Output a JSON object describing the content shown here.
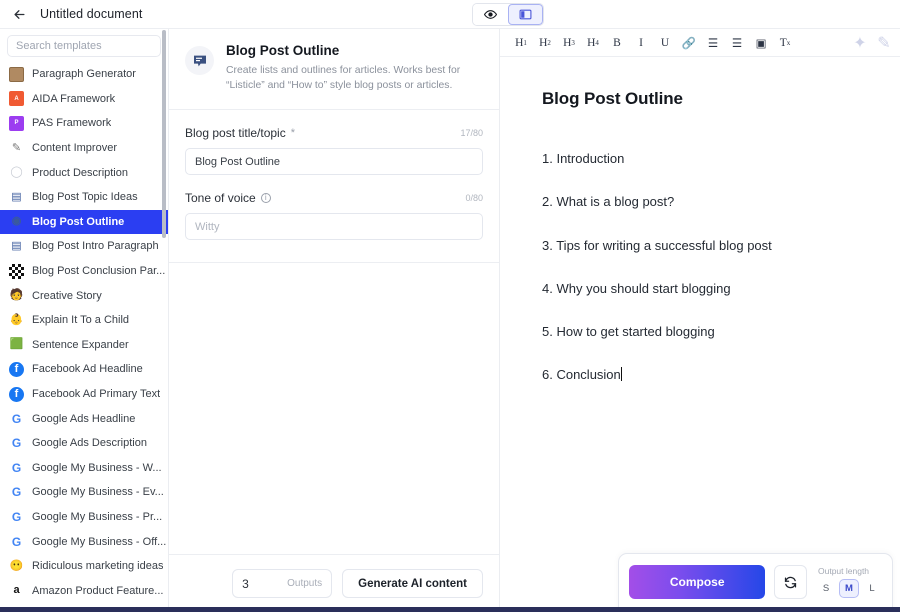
{
  "topbar": {
    "back_icon": "arrow-left-icon",
    "document_title": "Untitled document",
    "view_toggle": {
      "preview_icon": "eye-icon",
      "split_icon": "split-panel-icon",
      "active": "split"
    }
  },
  "sidebar": {
    "search": {
      "placeholder": "Search templates",
      "value": ""
    },
    "items": [
      {
        "label": "Paragraph Generator",
        "icon": "box-icon",
        "icon_class": "ic-box",
        "glyph": "",
        "selected": false
      },
      {
        "label": "AIDA Framework",
        "icon": "aida-badge-icon",
        "icon_class": "ic-aida",
        "glyph": "A",
        "selected": false
      },
      {
        "label": "PAS Framework",
        "icon": "pas-badge-icon",
        "icon_class": "ic-pas",
        "glyph": "P",
        "selected": false
      },
      {
        "label": "Content Improver",
        "icon": "magic-wand-icon",
        "icon_class": "ic-wand",
        "glyph": "✎",
        "selected": false
      },
      {
        "label": "Product Description",
        "icon": "speech-bubble-icon",
        "icon_class": "ic-bubble",
        "glyph": "◯",
        "selected": false
      },
      {
        "label": "Blog Post Topic Ideas",
        "icon": "chat-icon",
        "icon_class": "ic-chat",
        "glyph": "▤",
        "selected": false
      },
      {
        "label": "Blog Post Outline",
        "icon": "chat-circle-icon",
        "icon_class": "ic-chat",
        "glyph": "◉",
        "selected": true
      },
      {
        "label": "Blog Post Intro Paragraph",
        "icon": "chat-icon",
        "icon_class": "ic-chat",
        "glyph": "▤",
        "selected": false
      },
      {
        "label": "Blog Post Conclusion Par...",
        "icon": "checkered-flag-icon",
        "icon_class": "ic-flag",
        "glyph": "",
        "selected": false
      },
      {
        "label": "Creative Story",
        "icon": "person-icon",
        "icon_class": "",
        "glyph": "🧑",
        "selected": false
      },
      {
        "label": "Explain It To a Child",
        "icon": "baby-face-icon",
        "icon_class": "",
        "glyph": "👶",
        "selected": false
      },
      {
        "label": "Sentence Expander",
        "icon": "expand-icon",
        "icon_class": "",
        "glyph": "🟩",
        "selected": false
      },
      {
        "label": "Facebook Ad Headline",
        "icon": "facebook-icon",
        "icon_class": "ic-fb",
        "glyph": "f",
        "selected": false
      },
      {
        "label": "Facebook Ad Primary Text",
        "icon": "facebook-icon",
        "icon_class": "ic-fb",
        "glyph": "f",
        "selected": false
      },
      {
        "label": "Google Ads Headline",
        "icon": "google-icon",
        "icon_class": "ic-g",
        "glyph": "G",
        "selected": false
      },
      {
        "label": "Google Ads Description",
        "icon": "google-icon",
        "icon_class": "ic-g",
        "glyph": "G",
        "selected": false
      },
      {
        "label": "Google My Business - W...",
        "icon": "google-icon",
        "icon_class": "ic-g",
        "glyph": "G",
        "selected": false
      },
      {
        "label": "Google My Business - Ev...",
        "icon": "google-icon",
        "icon_class": "ic-g",
        "glyph": "G",
        "selected": false
      },
      {
        "label": "Google My Business - Pr...",
        "icon": "google-icon",
        "icon_class": "ic-g",
        "glyph": "G",
        "selected": false
      },
      {
        "label": "Google My Business - Off...",
        "icon": "google-icon",
        "icon_class": "ic-g",
        "glyph": "G",
        "selected": false
      },
      {
        "label": "Ridiculous marketing ideas",
        "icon": "smiley-icon",
        "icon_class": "",
        "glyph": "😶",
        "selected": false
      },
      {
        "label": "Amazon Product Feature...",
        "icon": "amazon-icon",
        "icon_class": "ic-amz",
        "glyph": "a",
        "selected": false
      }
    ]
  },
  "template_panel": {
    "icon": "chat-list-icon",
    "title": "Blog Post Outline",
    "description": "Create lists and outlines for articles. Works best for “Listicle” and “How to” style blog posts or articles.",
    "fields": [
      {
        "label": "Blog post title/topic",
        "required_marker": "*",
        "counter": "17/80",
        "value": "Blog Post Outline",
        "placeholder": ""
      },
      {
        "label": "Tone of voice",
        "info_icon": "info-icon",
        "counter": "0/80",
        "value": "",
        "placeholder": "Witty"
      }
    ],
    "footer": {
      "outputs_count": "3",
      "outputs_label": "Outputs",
      "generate_label": "Generate AI content"
    }
  },
  "editor": {
    "toolbar": [
      {
        "name": "heading-1-button",
        "label": "H",
        "sub": "1"
      },
      {
        "name": "heading-2-button",
        "label": "H",
        "sub": "2"
      },
      {
        "name": "heading-3-button",
        "label": "H",
        "sub": "3"
      },
      {
        "name": "heading-4-button",
        "label": "H",
        "sub": "4"
      },
      {
        "name": "bold-button",
        "label": "B",
        "sub": ""
      },
      {
        "name": "italic-button",
        "label": "I",
        "sub": ""
      },
      {
        "name": "underline-button",
        "label": "U",
        "sub": ""
      },
      {
        "name": "link-button",
        "label": "🔗",
        "sub": ""
      },
      {
        "name": "ordered-list-button",
        "label": "☰",
        "sub": ""
      },
      {
        "name": "bullet-list-button",
        "label": "☰",
        "sub": ""
      },
      {
        "name": "insert-image-button",
        "label": "▣",
        "sub": ""
      },
      {
        "name": "clear-format-button",
        "label": "T",
        "sub": "x"
      }
    ],
    "toolbar_right": [
      {
        "name": "ai-sparkle-icon",
        "glyph": "✦"
      },
      {
        "name": "edit-pencil-icon",
        "glyph": "✎"
      }
    ],
    "document": {
      "heading": "Blog Post Outline",
      "lines": [
        "1. Introduction",
        "2. What is a blog post?",
        "3. Tips for writing a successful blog post",
        "4. Why you should start blogging",
        "5. How to get started blogging",
        "6. Conclusion"
      ]
    }
  },
  "compose_bar": {
    "compose_label": "Compose",
    "regenerate_icon": "refresh-icon",
    "output_length_label": "Output length",
    "lengths": [
      {
        "label": "S",
        "active": false
      },
      {
        "label": "M",
        "active": true
      },
      {
        "label": "L",
        "active": false
      }
    ]
  },
  "colors": {
    "accent_blue": "#2b3ef2",
    "compose_gradient_start": "#a34ee8",
    "compose_gradient_end": "#2547e8",
    "toggle_active_bg": "#eef0fe",
    "footer_strip": "#2a2f5a"
  }
}
